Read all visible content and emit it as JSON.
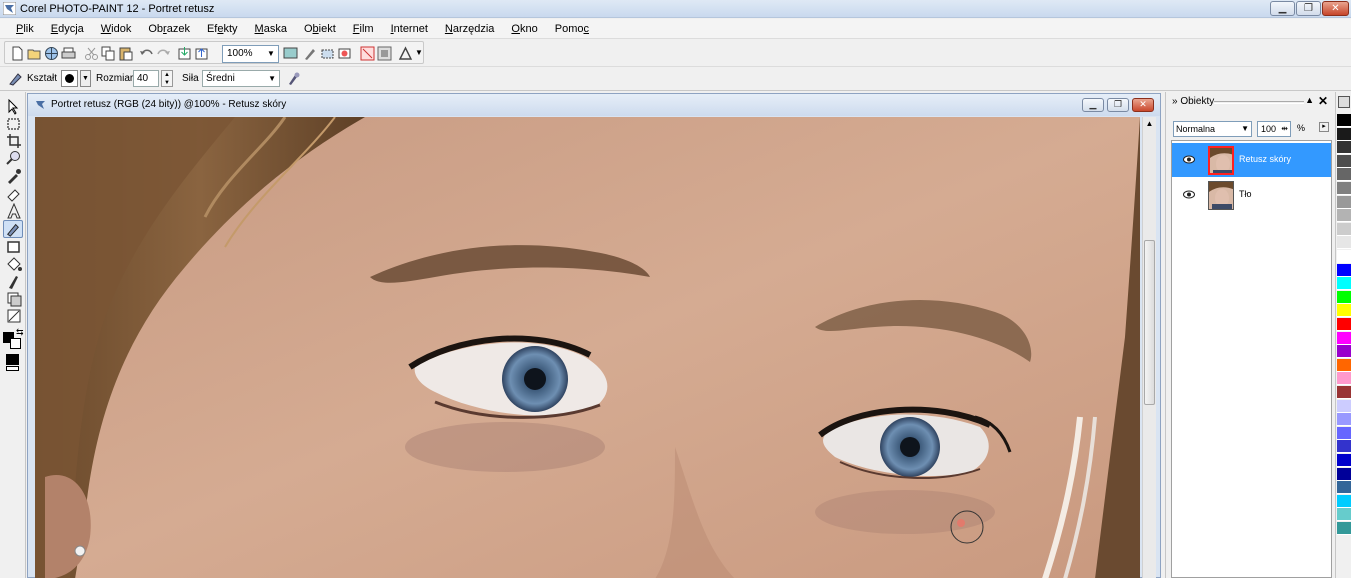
{
  "window": {
    "title": "Corel PHOTO-PAINT 12 - Portret retusz",
    "controls": [
      "minimize",
      "maximize",
      "close"
    ]
  },
  "menu": {
    "items": [
      {
        "pre": "",
        "u": "P",
        "post": "lik"
      },
      {
        "pre": "",
        "u": "E",
        "post": "dycja"
      },
      {
        "pre": "",
        "u": "W",
        "post": "idok"
      },
      {
        "pre": "Ob",
        "u": "r",
        "post": "azek"
      },
      {
        "pre": "Ef",
        "u": "e",
        "post": "kty"
      },
      {
        "pre": "",
        "u": "M",
        "post": "aska"
      },
      {
        "pre": "O",
        "u": "b",
        "post": "iekt"
      },
      {
        "pre": "",
        "u": "F",
        "post": "ilm"
      },
      {
        "pre": "",
        "u": "I",
        "post": "nternet"
      },
      {
        "pre": "",
        "u": "N",
        "post": "arzędzia"
      },
      {
        "pre": "",
        "u": "O",
        "post": "kno"
      },
      {
        "pre": "Pomo",
        "u": "c",
        "post": ""
      }
    ]
  },
  "toolbar": {
    "zoom_value": "100%"
  },
  "property_bar": {
    "shape_label": "Kształt",
    "size_label": "Rozmiar",
    "size_value": "40",
    "strength_label": "Siła",
    "strength_value": "Średni"
  },
  "document": {
    "title": "Portret retusz (RGB (24 bity)) @100% - Retusz skóry"
  },
  "objects_docker": {
    "title": "Obiekty",
    "blend_mode": "Normalna",
    "opacity": "100",
    "opacity_unit": "%",
    "layers": [
      {
        "name": "Retusz skóry",
        "selected": true,
        "visible": true
      },
      {
        "name": "Tło",
        "selected": false,
        "visible": true
      }
    ]
  },
  "palette": {
    "colors": [
      "#000000",
      "#1a1a1a",
      "#333333",
      "#4d4d4d",
      "#666666",
      "#808080",
      "#999999",
      "#b3b3b3",
      "#cccccc",
      "#e6e6e6",
      "#ffffff",
      "#0000ff",
      "#00ffff",
      "#00ff00",
      "#ffff00",
      "#ff0000",
      "#ff00ff",
      "#9900cc",
      "#ff6600",
      "#ff99cc",
      "#993333",
      "#ccccff",
      "#9999ff",
      "#6666ff",
      "#3333cc",
      "#0000cc",
      "#000099",
      "#336699",
      "#00ccff",
      "#66cccc",
      "#339999"
    ]
  }
}
